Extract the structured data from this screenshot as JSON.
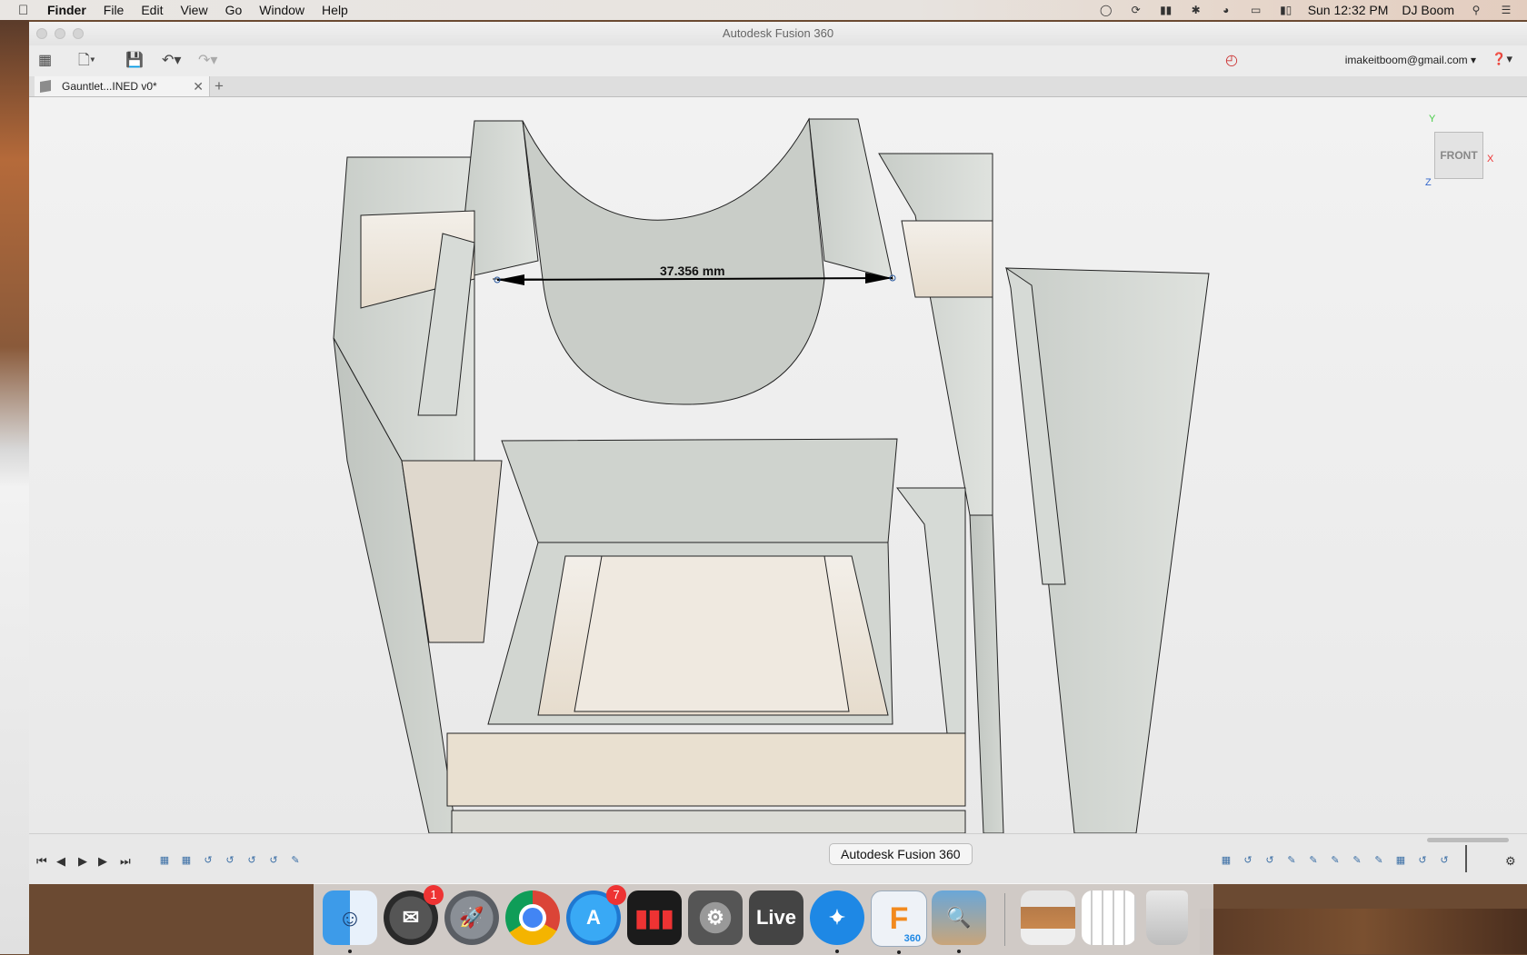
{
  "menubar": {
    "app": "Finder",
    "items": [
      "File",
      "Edit",
      "View",
      "Go",
      "Window",
      "Help"
    ],
    "clock": "Sun 12:32 PM",
    "user": "DJ Boom"
  },
  "window": {
    "title": "Autodesk Fusion 360",
    "account": "imakeitboom@gmail.com",
    "tab_label": "Gauntlet...INED v0*"
  },
  "viewport": {
    "dimension_label": "37.356 mm",
    "viewcube": {
      "face": "FRONT",
      "axis_x": "X",
      "axis_y": "Y",
      "axis_z": "Z"
    }
  },
  "dock": {
    "tooltip": "Autodesk Fusion 360",
    "items": [
      {
        "name": "Finder",
        "badge": ""
      },
      {
        "name": "Mail",
        "badge": "1"
      },
      {
        "name": "Launchpad",
        "badge": ""
      },
      {
        "name": "Chrome",
        "badge": ""
      },
      {
        "name": "App Store",
        "badge": "7"
      },
      {
        "name": "Stocks",
        "badge": ""
      },
      {
        "name": "System Preferences",
        "badge": ""
      },
      {
        "name": "Live",
        "label": "Live",
        "badge": ""
      },
      {
        "name": "Safari",
        "badge": ""
      },
      {
        "name": "Fusion 360",
        "label": "360",
        "badge": ""
      },
      {
        "name": "Preview",
        "badge": ""
      }
    ]
  },
  "colors": {
    "model_face": "#cfd3cf",
    "model_light": "#ede6dc",
    "dimension_line": "#000000",
    "axis_x": "#e33",
    "axis_y": "#4c4",
    "axis_z": "#36c"
  }
}
